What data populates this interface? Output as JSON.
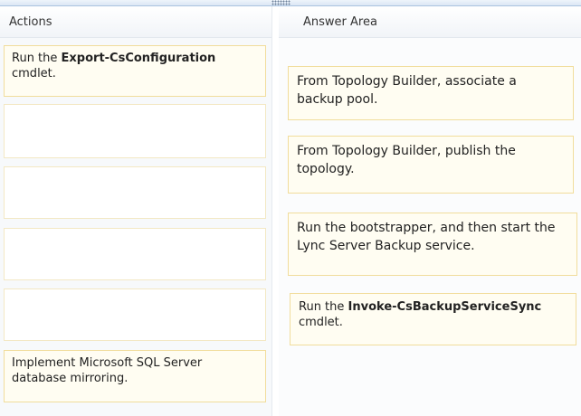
{
  "left_panel": {
    "header": "Actions",
    "cards": [
      {
        "pre": "Run the ",
        "bold": "Export-CsConfiguration",
        "post": " cmdlet."
      },
      {
        "text": "Implement Microsoft SQL Server database mirroring."
      }
    ]
  },
  "right_panel": {
    "header": "Answer Area",
    "cards": [
      {
        "text": "From Topology Builder, associate a backup pool."
      },
      {
        "text": "From Topology Builder, publish the topology."
      },
      {
        "text": "Run the bootstrapper, and then start the Lync Server Backup service."
      },
      {
        "pre": "Run the ",
        "bold": "Invoke-CsBackupServiceSync",
        "post": " cmdlet."
      }
    ]
  },
  "colors": {
    "card_border": "#f1dd9c",
    "card_background": "#fffdf2",
    "divider": "#a9c3e0"
  }
}
